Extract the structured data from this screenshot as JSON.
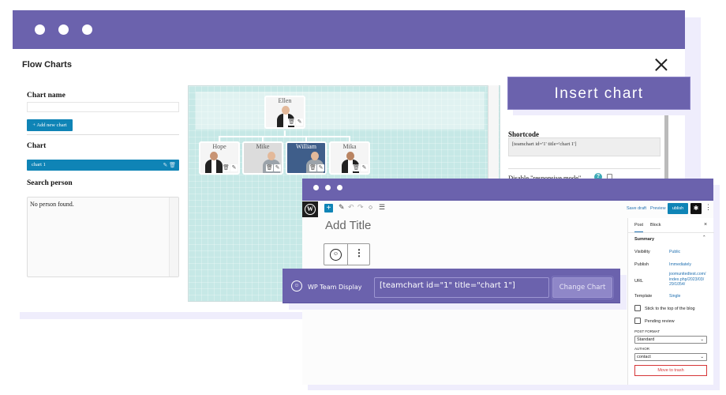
{
  "flow_window": {
    "title": "Flow Charts",
    "close_icon": "close-x-icon",
    "chart_name_label": "Chart name",
    "chart_name_value": "",
    "add_chart_label": "+ Add new chart",
    "chart_section_label": "Chart",
    "charts": [
      {
        "name": "chart 1",
        "edit_icon": "pencil-icon",
        "delete_icon": "trash-icon"
      }
    ],
    "search_label": "Search person",
    "search_result": "No person found.",
    "org_chart": {
      "root": {
        "name": "Ellen"
      },
      "children": [
        {
          "name": "Hope"
        },
        {
          "name": "Mike"
        },
        {
          "name": "William"
        },
        {
          "name": "Mika"
        }
      ],
      "node_icons": [
        "trash-icon",
        "pencil-icon"
      ]
    },
    "shortcode_label": "Shortcode",
    "shortcode_value": "[teamchart id='1' title='chart 1']",
    "responsive_label": "Disable \"responsive mode\"",
    "responsive_checked": false,
    "help_glyph": "?"
  },
  "insert_banner": {
    "label": "Insert chart"
  },
  "editor_window": {
    "toolbar": {
      "logo": "W",
      "add_glyph": "+",
      "icons": [
        "pencil-icon",
        "undo-icon",
        "redo-icon",
        "info-icon",
        "list-view-icon"
      ]
    },
    "title_placeholder": "Add Title",
    "header_actions": {
      "save_draft": "Save draft",
      "preview": "Preview",
      "publish": "ublish",
      "more_glyph": "⋮"
    },
    "sidebar": {
      "tabs": [
        "Post",
        "Block"
      ],
      "close_glyph": "×",
      "summary_label": "Summary",
      "rows": [
        {
          "key": "Visibility",
          "value": "Public"
        },
        {
          "key": "Publish",
          "value": "Immediately"
        },
        {
          "key": "URL",
          "value": "joomunitedtest.com/ index.php/2023/03/ 29/1054/"
        },
        {
          "key": "Template",
          "value": "Single"
        }
      ],
      "checkboxes": [
        {
          "label": "Stick to the top of the blog",
          "checked": false
        },
        {
          "label": "Pending review",
          "checked": false
        }
      ],
      "post_format_label": "POST FORMAT",
      "post_format_value": "Standard",
      "author_label": "AUTHOR",
      "author_value": "contact",
      "trash_label": "Move to trash"
    }
  },
  "plugin_block": {
    "label": "WP Team Display",
    "shortcode": "[teamchart id=\"1\" title=\"chart 1\"]",
    "change_button": "Change Chart"
  },
  "colors": {
    "brand_purple": "#6b62ad",
    "wp_blue": "#0f84b6",
    "canvas_teal": "#c6e8e6",
    "danger": "#d63638"
  }
}
